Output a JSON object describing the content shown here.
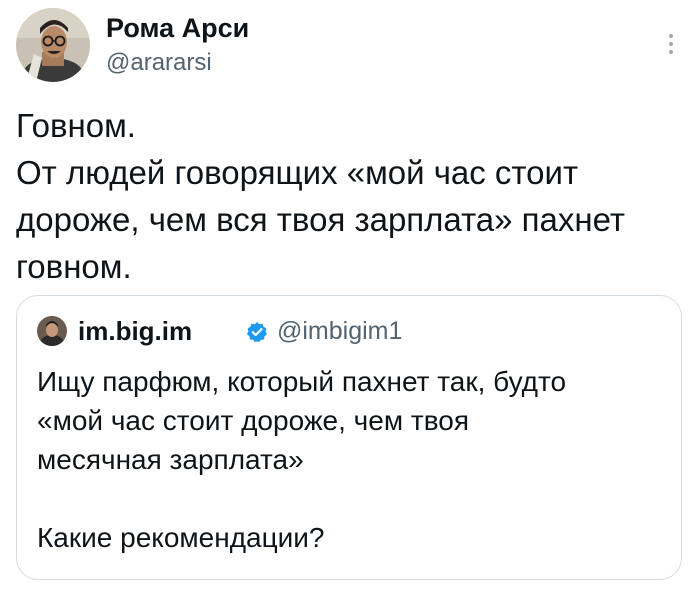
{
  "tweet": {
    "author": {
      "display_name": "Рома Арси",
      "handle": "@arararsi",
      "avatar_icon": "avatar-man-glasses"
    },
    "more_icon": "vertical-ellipsis-icon",
    "text_lines": [
      "Говном.",
      "От людей говорящих «мой час стоит",
      "дороже, чем вся твоя зарплата» пахнет",
      "говном."
    ]
  },
  "quoted_tweet": {
    "author": {
      "display_name": "im.big.im",
      "handle": "@imbigim1",
      "verified": true,
      "avatar_icon": "avatar-small"
    },
    "text_lines": [
      "Ищу парфюм, который пахнет так, будто",
      "«мой час стоит дороже, чем твоя",
      "месячная зарплата»",
      "",
      "Какие рекомендации?"
    ]
  },
  "colors": {
    "text_primary": "#0f1419",
    "text_secondary": "#536471",
    "verified_badge": "#1d9bf0",
    "border": "#d6dde3"
  }
}
